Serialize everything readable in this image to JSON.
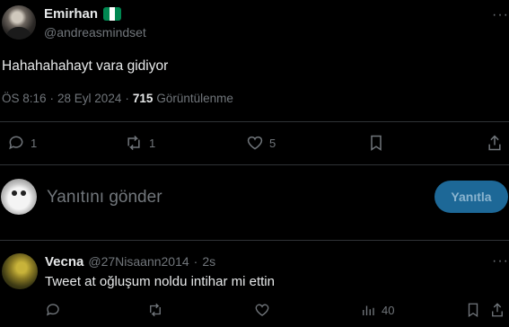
{
  "tweet": {
    "author_name": "Emirhan",
    "handle": "@andreasmindset",
    "text": "Hahahahahayt vara gidiyor",
    "time": "ÖS 8:16",
    "date": "28 Eyl 2024",
    "views_count": "715",
    "views_label": "Görüntülenme",
    "separator": "·",
    "more": "···",
    "actions": {
      "reply_count": "1",
      "retweet_count": "1",
      "like_count": "5"
    }
  },
  "composer": {
    "placeholder": "Yanıtını gönder",
    "reply_button": "Yanıtla"
  },
  "reply": {
    "author_name": "Vecna",
    "handle": "@27Nisaann2014",
    "separator": "·",
    "time": "2s",
    "text": "Tweet at oğluşum noldu intihar mi ettin",
    "more": "···",
    "views_count": "40"
  },
  "colors": {
    "background": "#000000",
    "text_primary": "#e7e9ea",
    "text_secondary": "#71767b",
    "divider": "#2f3336",
    "accent_button": "#1d6897",
    "flag_green": "#008751",
    "flag_white": "#ffffff"
  }
}
